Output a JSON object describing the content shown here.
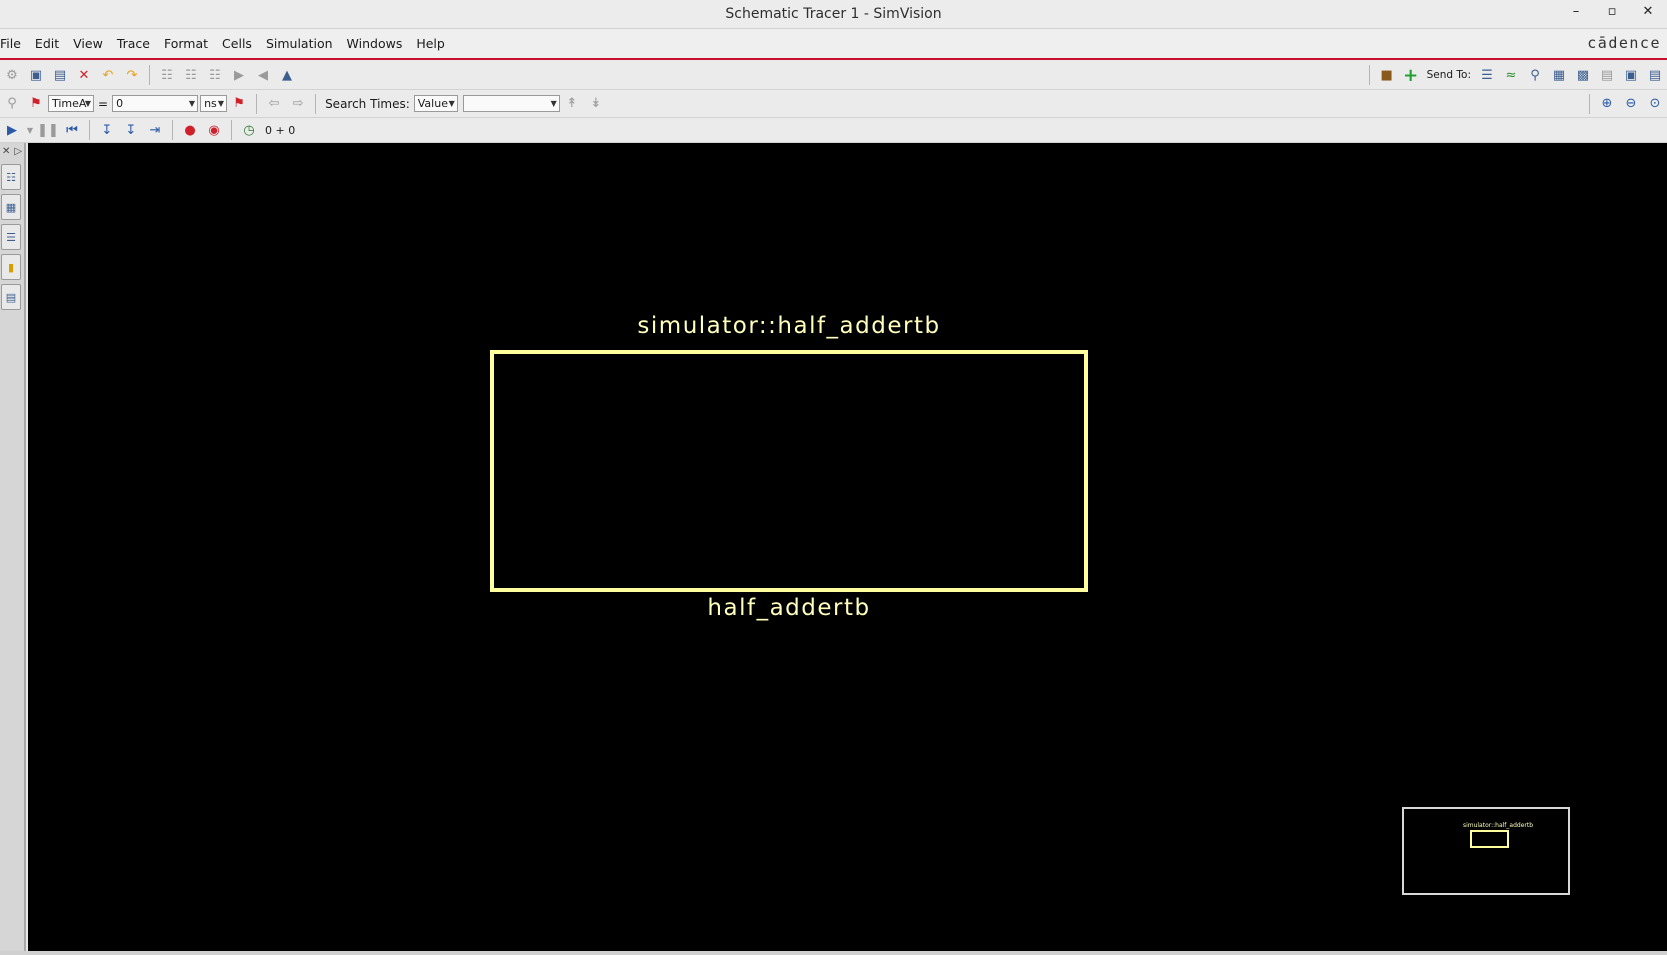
{
  "window": {
    "title": "Schematic Tracer 1 - SimVision",
    "controls": [
      "minimize-icon",
      "maximize-icon",
      "close-icon"
    ]
  },
  "menu": [
    "File",
    "Edit",
    "View",
    "Trace",
    "Format",
    "Cells",
    "Simulation",
    "Windows",
    "Help"
  ],
  "brand": "cādence",
  "toolbar2": {
    "time_mode": "TimeA",
    "equals": "=",
    "time_value": "0",
    "time_unit": "ns",
    "search_times_label": "Search Times:",
    "search_kind": "Value",
    "search_value": ""
  },
  "toolbar1": {
    "send_to_label": "Send To:"
  },
  "toolbar3": {
    "sim_time": "0 + 0"
  },
  "schematic": {
    "instance_path": "simulator::half_addertb",
    "cell_name": "half_addertb",
    "color": "#ffff9e"
  },
  "overview": {
    "label": "simulator::half_addertb"
  }
}
